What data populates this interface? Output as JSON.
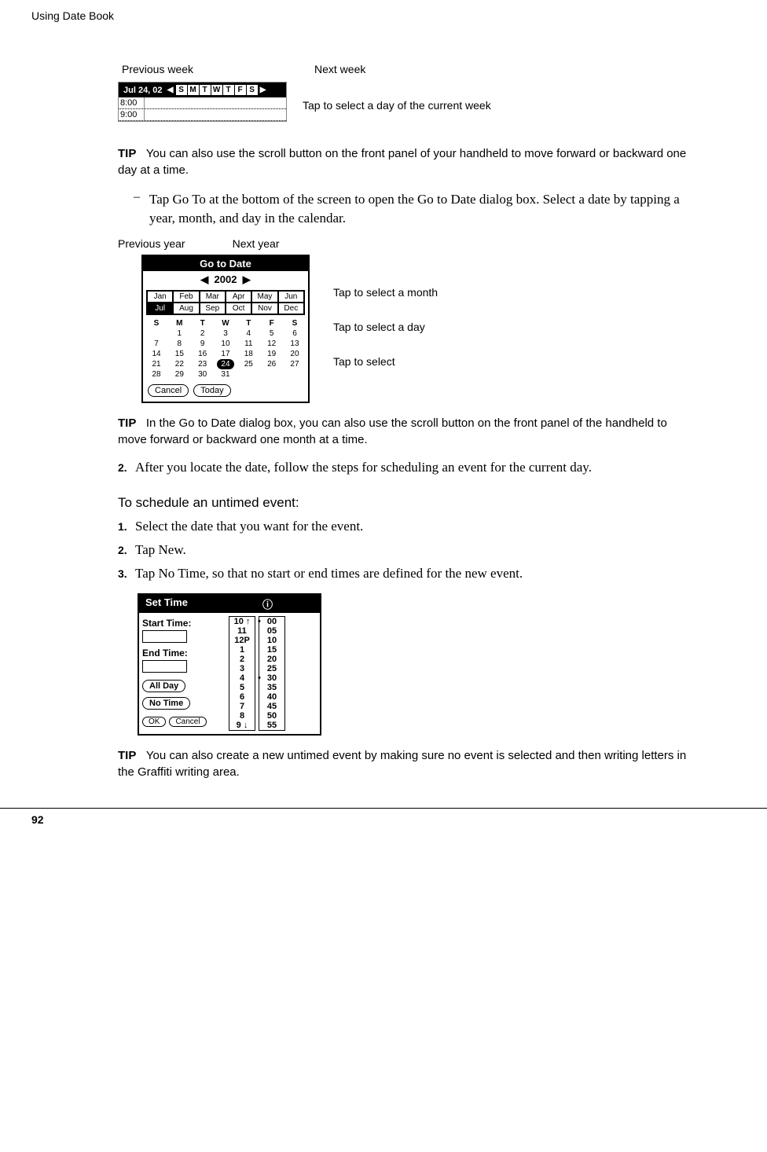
{
  "header": {
    "chapter": "Using Date Book"
  },
  "fig1": {
    "label_prev": "Previous week",
    "label_next": "Next week",
    "label_tap": "Tap to select a day of the current week",
    "date": "Jul 24, 02",
    "days": [
      "S",
      "M",
      "T",
      "W",
      "T",
      "F",
      "S"
    ],
    "times": [
      "8:00",
      "9:00"
    ]
  },
  "tip1": {
    "label": "TIP",
    "text": "You can also use the scroll button on the front panel of your handheld to move forward or backward one day at a time."
  },
  "dash1": {
    "text": "Tap Go To at the bottom of the screen to open the Go to Date dialog box. Select a date by tapping a year, month, and day in the calendar."
  },
  "fig2": {
    "label_prev_year": "Previous year",
    "label_next_year": "Next year",
    "label_month": "Tap to select a month",
    "label_day": "Tap to select a day",
    "label_today": "Tap to select",
    "title": "Go to Date",
    "year": "2002",
    "months": [
      "Jan",
      "Feb",
      "Mar",
      "Apr",
      "May",
      "Jun",
      "Jul",
      "Aug",
      "Sep",
      "Oct",
      "Nov",
      "Dec"
    ],
    "sel_month_idx": 6,
    "cal_head": [
      "S",
      "M",
      "T",
      "W",
      "T",
      "F",
      "S"
    ],
    "cal_rows": [
      [
        "",
        "1",
        "2",
        "3",
        "4",
        "5",
        "6"
      ],
      [
        "7",
        "8",
        "9",
        "10",
        "11",
        "12",
        "13"
      ],
      [
        "14",
        "15",
        "16",
        "17",
        "18",
        "19",
        "20"
      ],
      [
        "21",
        "22",
        "23",
        "24",
        "25",
        "26",
        "27"
      ],
      [
        "28",
        "29",
        "30",
        "31",
        "",
        "",
        ""
      ]
    ],
    "sel_day": "24",
    "btn_cancel": "Cancel",
    "btn_today": "Today"
  },
  "tip2": {
    "label": "TIP",
    "text": "In the Go to Date dialog box, you can also use the scroll button on the front panel of the handheld to move forward or backward one month at a time."
  },
  "step2_outer": {
    "num": "2.",
    "text": "After you locate the date, follow the steps for scheduling an event for the current day."
  },
  "subhead": "To schedule an untimed event:",
  "steps": [
    {
      "num": "1.",
      "text": "Select the date that you want for the event."
    },
    {
      "num": "2.",
      "text": "Tap New."
    },
    {
      "num": "3.",
      "text": "Tap No Time, so that no start or end times are defined for the new event."
    }
  ],
  "fig3": {
    "title": "Set Time",
    "start_label": "Start Time:",
    "end_label": "End Time:",
    "btn_allday": "All Day",
    "btn_notime": "No Time",
    "btn_ok": "OK",
    "btn_cancel": "Cancel",
    "hours": [
      "10",
      "11",
      "12P",
      "1",
      "2",
      "3",
      "4",
      "5",
      "6",
      "7",
      "8",
      "9"
    ],
    "minutes": [
      "00",
      "05",
      "10",
      "15",
      "20",
      "25",
      "30",
      "35",
      "40",
      "45",
      "50",
      "55"
    ],
    "hour_mark": "10",
    "min_mark_a": "00",
    "min_mark_b": "30"
  },
  "tip3": {
    "label": "TIP",
    "text": "You can also create a new untimed event by making sure no event is selected and then writing letters in the Graffiti writing area."
  },
  "footer": {
    "page": "92"
  }
}
